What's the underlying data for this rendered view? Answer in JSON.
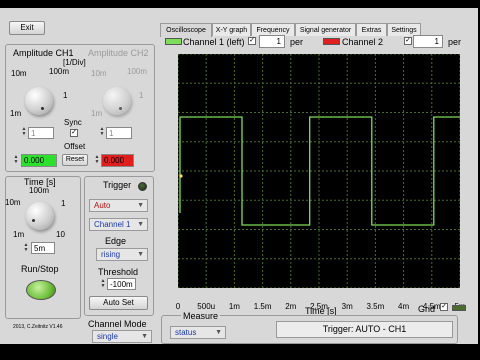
{
  "window": {
    "exit_label": "Exit",
    "version": "2013, C.Zeitnitz V1.46"
  },
  "tabs": [
    {
      "label": "Oscilloscope",
      "active": true
    },
    {
      "label": "X-Y graph"
    },
    {
      "label": "Frequency"
    },
    {
      "label": "Signal generator"
    },
    {
      "label": "Extras"
    },
    {
      "label": "Settings"
    }
  ],
  "amplitude": {
    "ch1_label": "Amplitude CH1",
    "ch2_label": "Amplitude CH2",
    "unit": "[1/Div]",
    "ch1_scale": [
      "10m",
      "100m",
      "1",
      "1m"
    ],
    "ch2_scale": [
      "10m",
      "100m",
      "1",
      "1m"
    ],
    "ch1_value": "1",
    "ch2_value": "1",
    "sync_label": "Sync",
    "offset_label": "Offset",
    "ch1_offset": "0.000",
    "ch2_offset": "0.000",
    "reset_label": "Reset"
  },
  "time": {
    "label": "Time [s]",
    "scale": [
      "100m",
      "10m",
      "1",
      "1m",
      "10"
    ],
    "value": "5m"
  },
  "runstop": {
    "label": "Run/Stop"
  },
  "trigger": {
    "label": "Trigger",
    "mode": "Auto",
    "channel": "Channel 1",
    "edge_label": "Edge",
    "edge": "rising",
    "threshold_label": "Threshold",
    "threshold": "-100m",
    "autoset_label": "Auto Set"
  },
  "channel_mode": {
    "label": "Channel Mode",
    "value": "single"
  },
  "channel_bar": {
    "ch1_label": "Channel 1 (left)",
    "ch1_per": "1",
    "ch2_label": "Channel 2",
    "ch2_per": "1",
    "per_label": "per",
    "ch1_color": "#7ddc5a",
    "ch2_color": "#e02020"
  },
  "scope": {
    "xlabel": "Time [s]",
    "x_ticks": [
      "0",
      "500u",
      "1m",
      "1.5m",
      "2m",
      "2.5m",
      "3m",
      "3.5m",
      "4m",
      "4.5m",
      "5m"
    ],
    "grid_label": "Grid",
    "trace_color": "#7ddc5a",
    "grid_color": "#4a6b2a"
  },
  "measure": {
    "label": "Measure",
    "value": "status"
  },
  "status": {
    "text": "Trigger: AUTO - CH1"
  },
  "chart_data": {
    "type": "line",
    "xlabel": "Time [s]",
    "x_ticks": [
      "0",
      "500u",
      "1m",
      "1.5m",
      "2m",
      "2.5m",
      "3m",
      "3.5m",
      "4m",
      "4.5m",
      "5m"
    ],
    "xlim": [
      0,
      0.005
    ],
    "grid": true,
    "series": [
      {
        "name": "Channel 1 (left)",
        "x": [
          0,
          0,
          0.0011,
          0.0011,
          0.0023,
          0.0023,
          0.0034,
          0.0034,
          0.0045,
          0.0045,
          0.005
        ],
        "y": [
          -0.7,
          0.9,
          0.9,
          -0.9,
          -0.9,
          0.9,
          0.9,
          -0.9,
          -0.9,
          0.9,
          0.9
        ]
      }
    ]
  }
}
